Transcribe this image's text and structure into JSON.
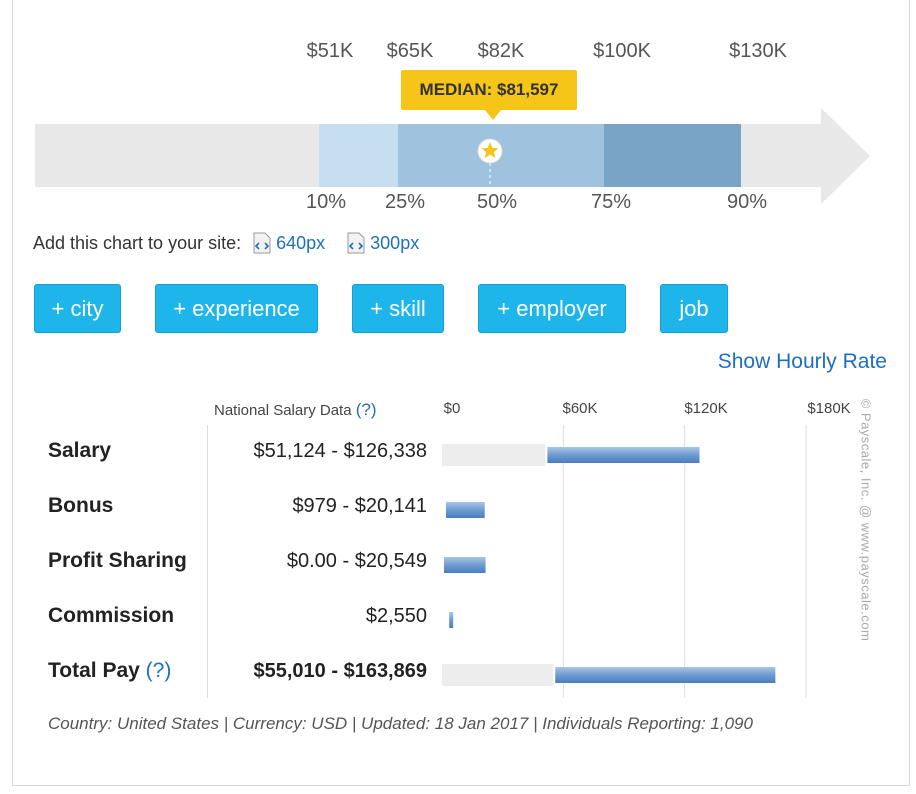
{
  "percentile_chart": {
    "value_labels": [
      "$51K",
      "$65K",
      "$82K",
      "$100K",
      "$130K"
    ],
    "percentile_labels": [
      "10%",
      "25%",
      "50%",
      "75%",
      "90%"
    ],
    "median_label": "MEDIAN: $81,597",
    "colors": {
      "track": "#e8e8e8",
      "band_10_25": "#c5def0",
      "band_25_75": "#9fc2de",
      "band_75_90": "#7aa4c6",
      "median_marker": "#f5c518"
    }
  },
  "add_chart": {
    "text": "Add this chart to your site:",
    "links": [
      "640px",
      "300px"
    ]
  },
  "buttons": {
    "city": "+ city",
    "experience": "+ experience",
    "skill": "+ skill",
    "employer": "+ employer",
    "job": "job"
  },
  "hourly_link": "Show Hourly Rate",
  "table": {
    "header": "National Salary Data",
    "header_help": "(?)",
    "axis_ticks": [
      "$0",
      "$60K",
      "$120K",
      "$180K"
    ],
    "rows": [
      {
        "label": "Salary",
        "range": "$51,124 - $126,338"
      },
      {
        "label": "Bonus",
        "range": "$979 - $20,141"
      },
      {
        "label": "Profit Sharing",
        "range": "$0.00 - $20,549"
      },
      {
        "label": "Commission",
        "range": "$2,550"
      },
      {
        "label": "Total Pay",
        "help": "(?)",
        "range": "$55,010 - $163,869"
      }
    ]
  },
  "chart_data": {
    "type": "bar",
    "categories": [
      "Salary",
      "Bonus",
      "Profit Sharing",
      "Commission",
      "Total Pay"
    ],
    "ranges": [
      [
        51124,
        126338
      ],
      [
        979,
        20141
      ],
      [
        0,
        20549
      ],
      [
        2550,
        2550
      ],
      [
        55010,
        163869
      ]
    ],
    "xlim": [
      0,
      180000
    ],
    "xticks": [
      "$0",
      "$60K",
      "$120K",
      "$180K"
    ],
    "grid": true
  },
  "footer": "Country: United States | Currency: USD | Updated: 18 Jan 2017 | Individuals Reporting: 1,090",
  "watermark": "© Payscale, Inc. @ www.payscale.com"
}
